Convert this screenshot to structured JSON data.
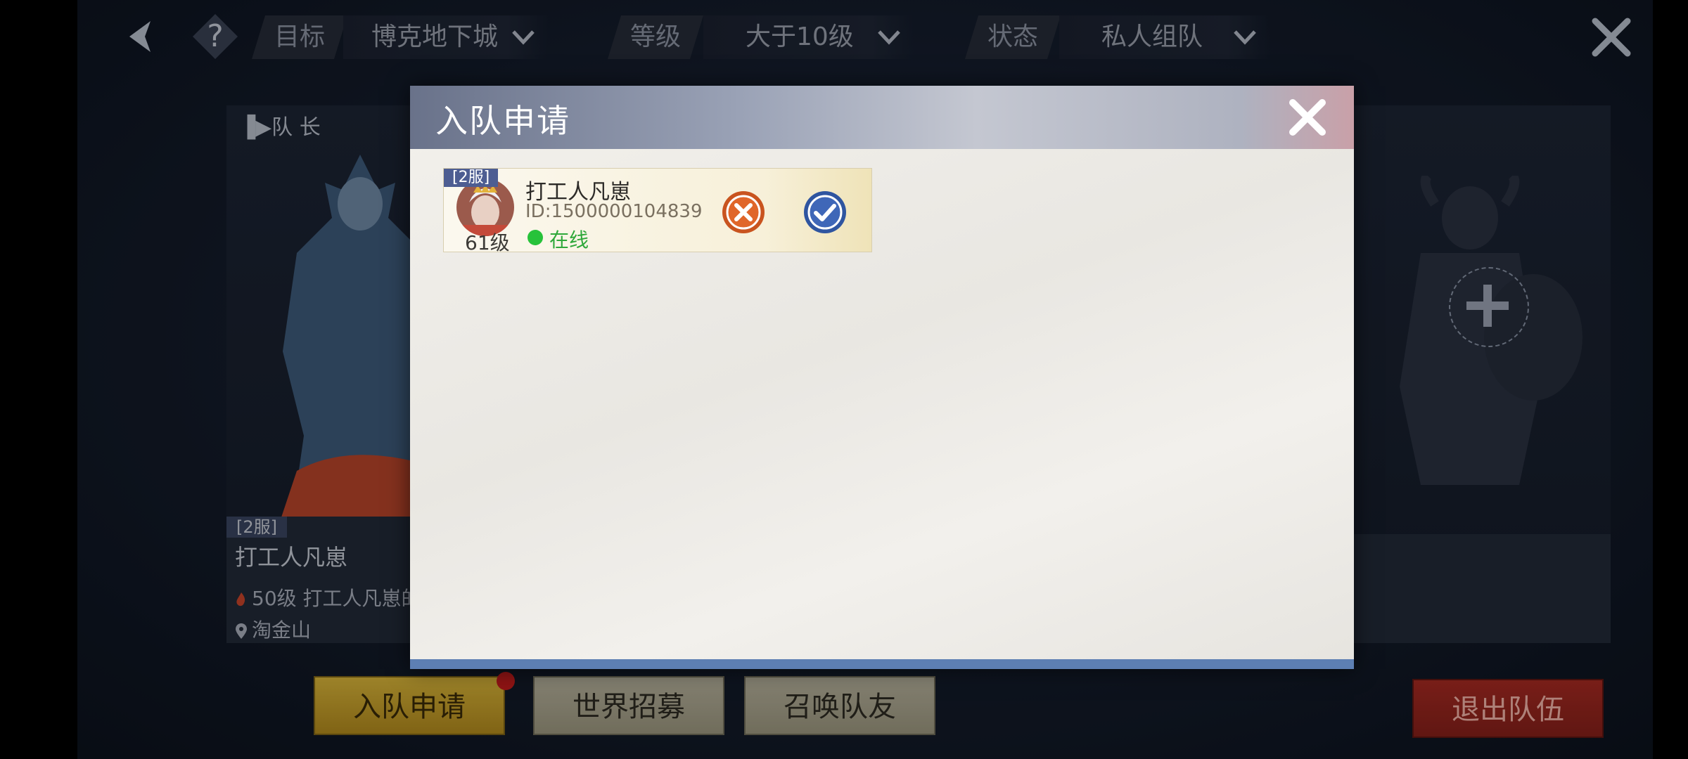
{
  "topbar": {
    "filters": [
      {
        "label": "目标",
        "value": "博克地下城"
      },
      {
        "label": "等级",
        "value": "大于10级"
      },
      {
        "label": "状态",
        "value": "私人组队"
      }
    ]
  },
  "team": {
    "leader_tag": "队 长",
    "leader_server": "[2服]",
    "leader_name": "打工人凡崽",
    "leader_desc": "50级 打工人凡崽的",
    "leader_location": "淘金山"
  },
  "bottom_buttons": {
    "apply": "入队申请",
    "world_recruit": "世界招募",
    "summon": "召唤队友",
    "quit": "退出队伍"
  },
  "modal": {
    "title": "入队申请",
    "applicants": [
      {
        "server": "[2服]",
        "level": "61级",
        "name": "打工人凡崽",
        "id": "ID:1500000104839",
        "status": "在线"
      }
    ]
  },
  "colors": {
    "accent_gold": "#d9b53a",
    "quit_red": "#a72a22",
    "online_green": "#27c23a",
    "reject_orange": "#e0662a",
    "accept_blue": "#3f67b8"
  },
  "icons": [
    "back-icon",
    "help-icon",
    "chevron-down-icon",
    "close-icon",
    "fire-icon",
    "location-pin-icon",
    "plus-icon",
    "reject-icon",
    "accept-icon"
  ]
}
